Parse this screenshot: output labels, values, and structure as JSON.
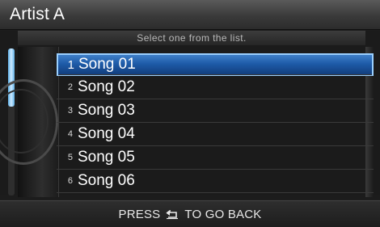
{
  "header": {
    "title": "Artist A"
  },
  "subheader": {
    "text": "Select one from the list."
  },
  "list": {
    "selected_index": 0,
    "items": [
      {
        "number": "1",
        "label": "Song 01"
      },
      {
        "number": "2",
        "label": "Song 02"
      },
      {
        "number": "3",
        "label": "Song 03"
      },
      {
        "number": "4",
        "label": "Song 04"
      },
      {
        "number": "5",
        "label": "Song 05"
      },
      {
        "number": "6",
        "label": "Song 06"
      }
    ]
  },
  "footer": {
    "text_before_icon": "PRESS",
    "icon": "back-arrow-icon",
    "text_after_icon": "TO GO BACK"
  },
  "colors": {
    "selection": "#1e5ba8",
    "selection_border": "#9bd0ff",
    "scroll_thumb": "#5fb0e6"
  }
}
